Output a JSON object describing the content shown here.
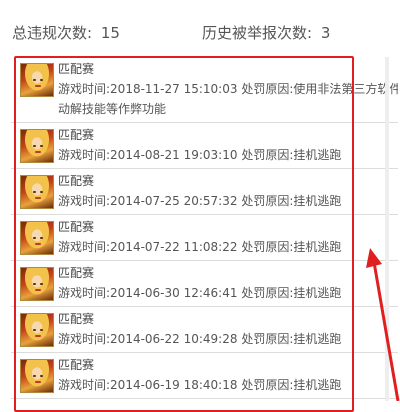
{
  "stats": {
    "total_violations_label": "总违规次数:",
    "total_violations_value": "15",
    "reported_label": "历史被举报次数:",
    "reported_value": "3"
  },
  "records": [
    {
      "mode": "匹配赛",
      "time_label": "游戏时间:",
      "time": "2018-11-27 15:10:03",
      "reason_label": "处罚原因:",
      "reason": "使用非法第三方软件",
      "reason_cont": "动解技能等作弊功能"
    },
    {
      "mode": "匹配赛",
      "time_label": "游戏时间:",
      "time": "2014-08-21 19:03:10",
      "reason_label": "处罚原因:",
      "reason": "挂机逃跑"
    },
    {
      "mode": "匹配赛",
      "time_label": "游戏时间:",
      "time": "2014-07-25 20:57:32",
      "reason_label": "处罚原因:",
      "reason": "挂机逃跑"
    },
    {
      "mode": "匹配赛",
      "time_label": "游戏时间:",
      "time": "2014-07-22 11:08:22",
      "reason_label": "处罚原因:",
      "reason": "挂机逃跑"
    },
    {
      "mode": "匹配赛",
      "time_label": "游戏时间:",
      "time": "2014-06-30 12:46:41",
      "reason_label": "处罚原因:",
      "reason": "挂机逃跑"
    },
    {
      "mode": "匹配赛",
      "time_label": "游戏时间:",
      "time": "2014-06-22 10:49:28",
      "reason_label": "处罚原因:",
      "reason": "挂机逃跑"
    },
    {
      "mode": "匹配赛",
      "time_label": "游戏时间:",
      "time": "2014-06-19 18:40:18",
      "reason_label": "处罚原因:",
      "reason": "挂机逃跑"
    }
  ],
  "colors": {
    "highlight": "#e02020",
    "divider": "#dcdcdc"
  },
  "icons": {
    "avatar": "hero-avatar-icon",
    "annotation": "red-arrow-icon"
  }
}
